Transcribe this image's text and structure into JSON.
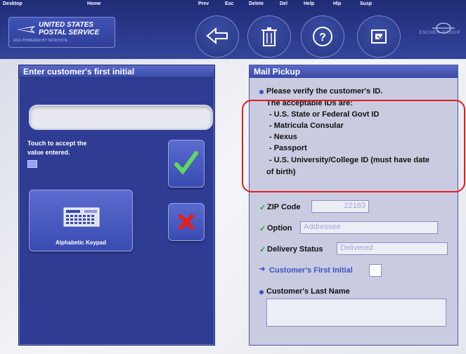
{
  "topbar": {
    "desktop_label": "Desktop",
    "home_label": "Home",
    "prev_label": "Prev",
    "esc_label": "Esc",
    "delete_label": "Delete",
    "del_label": "Del",
    "help_label": "Help",
    "hlp_label": "Hlp",
    "susp_label": "Susp",
    "logo_line1": "UNITED STATES",
    "logo_line2": "POSTAL SERVICE",
    "logo_line3": "RSS POWERED BY NCR/OSTE",
    "brand_text": "ESCHER GROUP"
  },
  "left_panel": {
    "title": "Enter customer's first initial",
    "input_value": "",
    "hint_line1": "Touch to accept the",
    "hint_line2": "value entered.",
    "keypad_label": "Alphabetic Keypad"
  },
  "right_panel": {
    "title": "Mail Pickup",
    "verify_line": "Please verify the customer's ID.",
    "ids_intro": "The acceptable IDs are:",
    "ids": [
      "- U.S. State or Federal Govt ID",
      "- Matricula Consular",
      "- Nexus",
      "- Passport",
      "- U.S. University/College ID (must have date",
      "of birth)"
    ],
    "zip_label": "ZIP Code",
    "zip_value": "22183",
    "option_label": "Option",
    "option_value": "Addressee",
    "delivery_label": "Delivery Status",
    "delivery_value": "Delivered",
    "first_initial_label": "Customer's First Initial",
    "last_name_label": "Customer's Last Name",
    "last_name_value": ""
  },
  "colors": {
    "accent": "#2e3c93",
    "highlight": "#e02020",
    "check_green": "#2ca12c",
    "cancel_red": "#e32020"
  }
}
